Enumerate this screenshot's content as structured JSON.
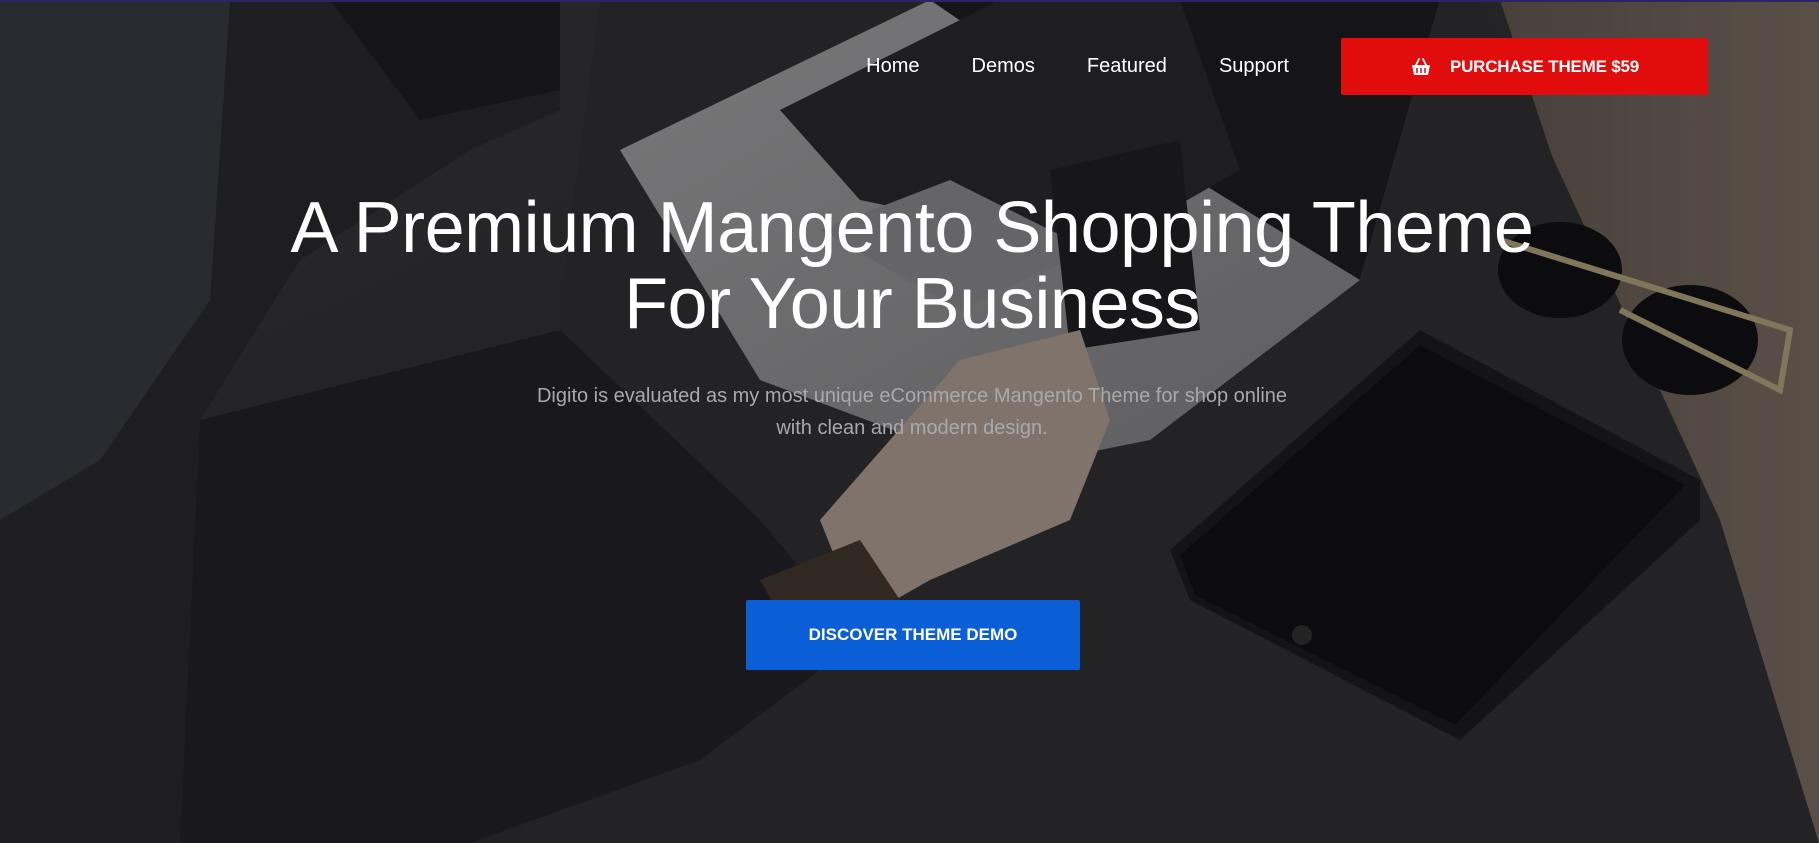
{
  "header": {
    "nav": [
      "Home",
      "Demos",
      "Featured",
      "Support"
    ],
    "purchase_label": "PURCHASE THEME $59",
    "purchase_icon": "basket-icon"
  },
  "hero": {
    "headline_line1": "A Premium Mangento Shopping Theme",
    "headline_line2": "For Your Business",
    "subtitle_line1": "Digito is evaluated as my most unique eCommerce Mangento Theme for shop online",
    "subtitle_line2": "with clean and modern design.",
    "cta_label": "DISCOVER THEME DEMO",
    "background": "person-using-smartphone-at-desk-photo"
  },
  "colors": {
    "purchase_button": "#e10c0c",
    "cta_button": "#0a5fd6",
    "nav_text": "#ffffff",
    "subtitle_text": "#a9a9ab"
  }
}
